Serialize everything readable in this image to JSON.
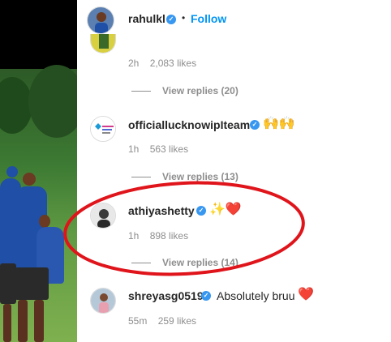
{
  "header": {
    "username": "rahulkl",
    "separator": "•",
    "follow_label": "Follow"
  },
  "comments": [
    {
      "time": "2h",
      "likes": "2,083 likes",
      "replies": "View replies (20)"
    },
    {
      "username": "officiallucknowipIteam",
      "emojis": "🙌🙌",
      "time": "1h",
      "likes": "563 likes",
      "replies": "View replies (13)"
    },
    {
      "username": "athiyashetty",
      "emojis": "✨❤️",
      "time": "1h",
      "likes": "898 likes",
      "replies": "View replies (14)"
    },
    {
      "username": "shreyasg0519",
      "text": "Absolutely bruu",
      "emojis": "❤️",
      "time": "55m",
      "likes": "259 likes"
    }
  ],
  "colors": {
    "follow": "#0095f6",
    "verified": "#3897f0",
    "highlight": "#e0141b"
  },
  "icons": {
    "verified": "verified-badge-icon",
    "hands": "raising-hands-emoji",
    "sparkles": "sparkles-emoji",
    "heart": "red-heart-emoji"
  }
}
